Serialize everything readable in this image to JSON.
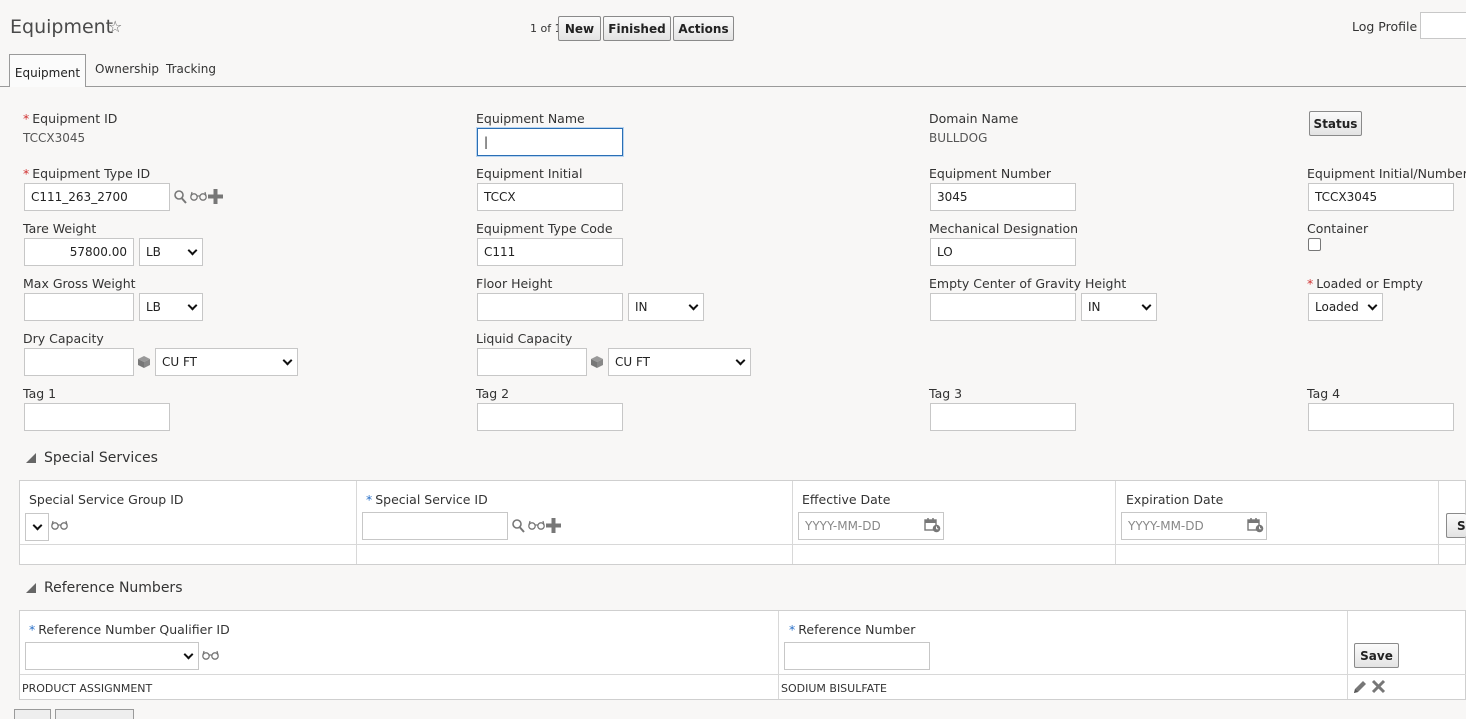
{
  "header": {
    "title": "Equipment",
    "pager": "1 of 1",
    "buttons": {
      "new": "New",
      "finished": "Finished",
      "actions": "Actions"
    },
    "log_profile_label": "Log Profile",
    "log_profile_value": ""
  },
  "tabs": [
    {
      "label": "Equipment",
      "active": true
    },
    {
      "label": "Ownership",
      "active": false
    },
    {
      "label": "Tracking",
      "active": false
    }
  ],
  "form": {
    "equipment_id": {
      "label": "Equipment ID",
      "value": "TCCX3045"
    },
    "equipment_name": {
      "label": "Equipment Name",
      "value": "|"
    },
    "domain_name": {
      "label": "Domain Name",
      "value": "BULLDOG"
    },
    "status_button": "Status",
    "equipment_type_id": {
      "label": "Equipment Type ID",
      "value": "C111_263_2700"
    },
    "equipment_initial": {
      "label": "Equipment Initial",
      "value": "TCCX"
    },
    "equipment_number": {
      "label": "Equipment Number",
      "value": "3045"
    },
    "equipment_initial_number": {
      "label": "Equipment Initial/Number",
      "value": "TCCX3045"
    },
    "tare_weight": {
      "label": "Tare Weight",
      "value": "57800.00",
      "unit": "LB"
    },
    "equipment_type_code": {
      "label": "Equipment Type Code",
      "value": "C111"
    },
    "mechanical_designation": {
      "label": "Mechanical Designation",
      "value": "LO"
    },
    "container": {
      "label": "Container",
      "checked": false
    },
    "max_gross_weight": {
      "label": "Max Gross Weight",
      "value": "",
      "unit": "LB"
    },
    "floor_height": {
      "label": "Floor Height",
      "value": "",
      "unit": "IN"
    },
    "empty_cog_height": {
      "label": "Empty Center of Gravity Height",
      "value": "",
      "unit": "IN"
    },
    "loaded_or_empty": {
      "label": "Loaded or Empty",
      "value": "Loaded"
    },
    "dry_capacity": {
      "label": "Dry Capacity",
      "value": "",
      "unit": "CU FT"
    },
    "liquid_capacity": {
      "label": "Liquid Capacity",
      "value": "",
      "unit": "CU FT"
    },
    "tag1": {
      "label": "Tag 1",
      "value": ""
    },
    "tag2": {
      "label": "Tag 2",
      "value": ""
    },
    "tag3": {
      "label": "Tag 3",
      "value": ""
    },
    "tag4": {
      "label": "Tag 4",
      "value": ""
    }
  },
  "special_services": {
    "title": "Special Services",
    "columns": [
      "Special Service Group ID",
      "Special Service ID",
      "Effective Date",
      "Expiration Date"
    ],
    "date_placeholder": "YYYY-MM-DD",
    "save_label": "Sa"
  },
  "reference_numbers": {
    "title": "Reference Numbers",
    "columns": [
      "Reference Number Qualifier ID",
      "Reference Number"
    ],
    "save_label": "Save",
    "rows": [
      {
        "qualifier": "PRODUCT ASSIGNMENT",
        "number": "SODIUM BISULFATE"
      }
    ]
  }
}
